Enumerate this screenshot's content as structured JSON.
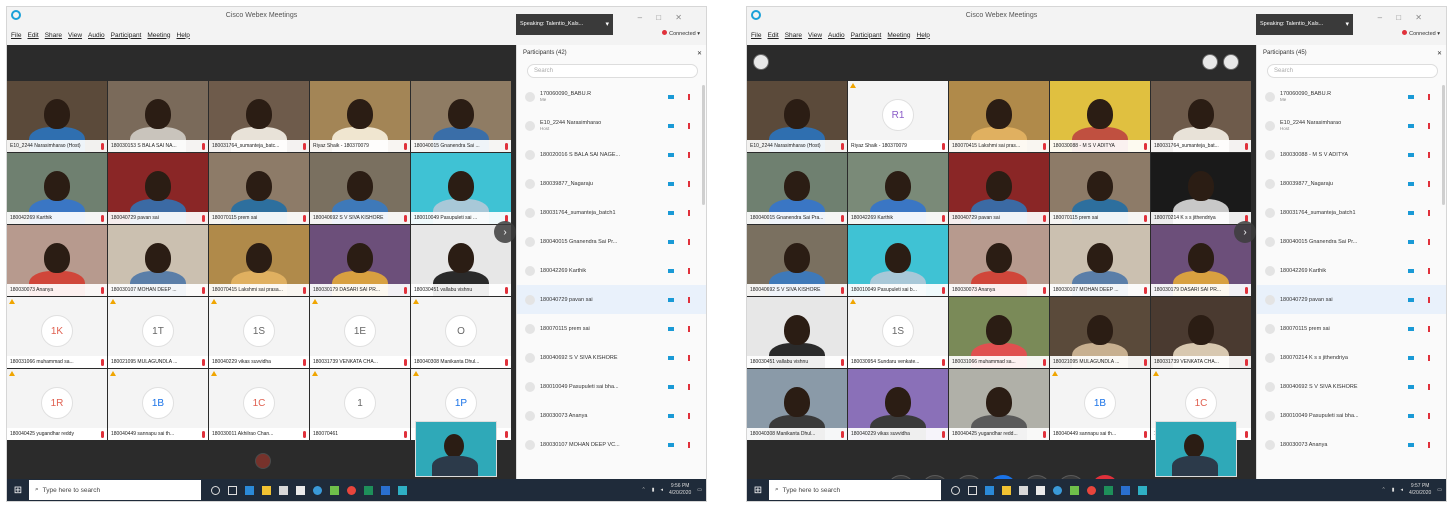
{
  "left": {
    "window_title": "Cisco Webex Meetings",
    "menu": [
      "File",
      "Edit",
      "Share",
      "View",
      "Audio",
      "Participant",
      "Meeting",
      "Help"
    ],
    "speaking": "Speaking: Talentio_Kals...",
    "connected": "Connected",
    "participants_label": "Participants (42)",
    "search_placeholder": "Search",
    "tiles": [
      {
        "label": "E10_2244 Narasimharao (Host)",
        "kind": "video",
        "bg": "#5b4a3a",
        "shirt": "#2f6fb0"
      },
      {
        "label": "180030153 S BALA SAI NA...",
        "kind": "video",
        "bg": "#7a6a5a",
        "shirt": "#c9c4bc"
      },
      {
        "label": "180031764_sumanteja_batc...",
        "kind": "video",
        "bg": "#6e5b4b",
        "shirt": "#e8e2d8"
      },
      {
        "label": "Riyaz Shaik - 180370079",
        "kind": "video",
        "bg": "#a38556",
        "shirt": "#f0e6d0"
      },
      {
        "label": "180040015 Gnanendra Sai ...",
        "kind": "video",
        "bg": "#8f7c64",
        "shirt": "#3a6ea8"
      },
      {
        "label": "180042269 Karthik",
        "kind": "video",
        "bg": "#6f8070",
        "shirt": "#3a76c4"
      },
      {
        "label": "180040729 pavan sai",
        "kind": "video",
        "bg": "#8a2626",
        "shirt": "#3b6aa4"
      },
      {
        "label": "180070115 prem sai",
        "kind": "video",
        "bg": "#8d7b68",
        "shirt": "#2d6f9e"
      },
      {
        "label": "180040692 S V SIVA KISHORE",
        "kind": "video",
        "bg": "#7a7060",
        "shirt": "#3e79b9"
      },
      {
        "label": "180010049 Pasupuleti sai ...",
        "kind": "video",
        "bg": "#3fc2d4",
        "shirt": "#a8c8d8"
      },
      {
        "label": "180030073 Ananya",
        "kind": "video",
        "bg": "#b79a8e",
        "shirt": "#d0463a"
      },
      {
        "label": "180030107 MOHAN DEEP ...",
        "kind": "video",
        "bg": "#cbc0b0",
        "shirt": "#5a7ea8"
      },
      {
        "label": "180070415 Lakshmi sai prasa...",
        "kind": "video",
        "bg": "#b08a4a",
        "shirt": "#e0b060"
      },
      {
        "label": "180030179 DASARI SAI PR...",
        "kind": "video",
        "bg": "#6c4f7a",
        "shirt": "#d8a040"
      },
      {
        "label": "180030451 vallabu vishnu",
        "kind": "video",
        "bg": "#e7e7e7",
        "shirt": "#2a2a2a"
      },
      {
        "label": "180031066 muhammad sa...",
        "kind": "avatar",
        "initials": "1K",
        "color": "#e06050"
      },
      {
        "label": "180021095 MULAGUNDLA ...",
        "kind": "avatar",
        "initials": "1T",
        "color": "#666666"
      },
      {
        "label": "180040229 vikas suvvidha",
        "kind": "avatar",
        "initials": "1S",
        "color": "#666666"
      },
      {
        "label": "180031739 VENKATA CHA...",
        "kind": "avatar",
        "initials": "1E",
        "color": "#666666"
      },
      {
        "label": "180040308 Manikanta Dhul...",
        "kind": "avatar",
        "initials": "O",
        "color": "#666666"
      },
      {
        "label": "180040425 yugandhar reddy",
        "kind": "avatar",
        "initials": "1R",
        "color": "#e06050"
      },
      {
        "label": "180040449 sannapu sai th...",
        "kind": "avatar",
        "initials": "1B",
        "color": "#1a73e8"
      },
      {
        "label": "180030011 Akhilrao Chan...",
        "kind": "avatar",
        "initials": "1C",
        "color": "#e06050"
      },
      {
        "label": "180070461",
        "kind": "avatar",
        "initials": "1",
        "color": "#666666"
      },
      {
        "label": "",
        "kind": "avatar",
        "initials": "1P",
        "color": "#1a73e8"
      }
    ],
    "participants": [
      {
        "name": "170060090_BABU.R",
        "sub": "Me"
      },
      {
        "name": "E10_2244 Narasimharao",
        "sub": "Host"
      },
      {
        "name": "180020016 S BALA SAI NAGE...",
        "sub": ""
      },
      {
        "name": "180039877_Nagaraju",
        "sub": ""
      },
      {
        "name": "180031764_sumanteja_batch1",
        "sub": ""
      },
      {
        "name": "180040015 Gnanendra Sai Pr...",
        "sub": ""
      },
      {
        "name": "180042269 Karthik",
        "sub": ""
      },
      {
        "name": "180040729 pavan sai",
        "sub": ""
      },
      {
        "name": "180070115 prem sai",
        "sub": ""
      },
      {
        "name": "180040692 S V SIVA KISHORE",
        "sub": ""
      },
      {
        "name": "180010049 Pasupuleti sai bha...",
        "sub": ""
      },
      {
        "name": "180030073 Ananya",
        "sub": ""
      },
      {
        "name": "180030107 MOHAN DEEP VC...",
        "sub": ""
      }
    ],
    "taskbar_search": "Type here to search",
    "clock_time": "9:56 PM",
    "clock_date": "4/20/2020"
  },
  "right": {
    "window_title": "Cisco Webex Meetings",
    "menu": [
      "File",
      "Edit",
      "Share",
      "View",
      "Audio",
      "Participant",
      "Meeting",
      "Help"
    ],
    "speaking": "Speaking: Talentio_Kals...",
    "connected": "Connected",
    "participants_label": "Participants (45)",
    "search_placeholder": "Search",
    "tiles": [
      {
        "label": "E10_2244 Narasimharao (Host)",
        "kind": "video",
        "bg": "#5b4a3a",
        "shirt": "#2f6fb0"
      },
      {
        "label": "Riyaz Shaik - 180370079",
        "kind": "avatar",
        "initials": "R1",
        "color": "#8a5cc8"
      },
      {
        "label": "180070415 Lakshmi sai pras...",
        "kind": "video",
        "bg": "#b08a4a",
        "shirt": "#e0b060"
      },
      {
        "label": "180030088 - M S V ADITYA",
        "kind": "video",
        "bg": "#e0c040",
        "shirt": "#c05040"
      },
      {
        "label": "180031764_sumanteja_bat...",
        "kind": "video",
        "bg": "#6e5b4b",
        "shirt": "#e8e2d8"
      },
      {
        "label": "180040015 Gnanendra Sai Pra...",
        "kind": "video",
        "bg": "#6f8070",
        "shirt": "#3a76c4"
      },
      {
        "label": "180042269 Karthik",
        "kind": "video",
        "bg": "#7a8a78",
        "shirt": "#3a76c4"
      },
      {
        "label": "180040729 pavan sai",
        "kind": "video",
        "bg": "#8a2626",
        "shirt": "#3b6aa4"
      },
      {
        "label": "180070115 prem sai",
        "kind": "video",
        "bg": "#8d7b68",
        "shirt": "#2d6f9e"
      },
      {
        "label": "180070214 K s s jithendriya",
        "kind": "video",
        "bg": "#1a1a1a",
        "shirt": "#c8c8c8"
      },
      {
        "label": "180040692 S V SIVA KISHORE",
        "kind": "video",
        "bg": "#7a7060",
        "shirt": "#3e79b9"
      },
      {
        "label": "180010049 Pasupuleti sai b...",
        "kind": "video",
        "bg": "#3fc2d4",
        "shirt": "#a8c8d8"
      },
      {
        "label": "180030073 Ananya",
        "kind": "video",
        "bg": "#b79a8e",
        "shirt": "#d0463a"
      },
      {
        "label": "180030107 MOHAN DEEP ...",
        "kind": "video",
        "bg": "#cbc0b0",
        "shirt": "#5a7ea8"
      },
      {
        "label": "180030179 DASARI SAI PR...",
        "kind": "video",
        "bg": "#6c4f7a",
        "shirt": "#d8a040"
      },
      {
        "label": "180030451 vallabu vishnu",
        "kind": "video",
        "bg": "#e7e7e7",
        "shirt": "#2a2a2a"
      },
      {
        "label": "180030954 Sundaru venkate...",
        "kind": "avatar",
        "initials": "1S",
        "color": "#666666"
      },
      {
        "label": "180031066 muhammad sa...",
        "kind": "video",
        "bg": "#7a8a58",
        "shirt": "#e05050"
      },
      {
        "label": "180021095 MULAGUNDLA ...",
        "kind": "video",
        "bg": "#5a4a3a",
        "shirt": "#c8b090"
      },
      {
        "label": "180031739 VENKATA CHA...",
        "kind": "video",
        "bg": "#4a3a30",
        "shirt": "#d8c8b0"
      },
      {
        "label": "180040308 Manikanta Dhul...",
        "kind": "video",
        "bg": "#8a9aa8",
        "shirt": "#3a3a3a"
      },
      {
        "label": "180040229 vikas suvvidha",
        "kind": "video",
        "bg": "#8a70b8",
        "shirt": "#3a3a3a"
      },
      {
        "label": "180040425 yugandhar redd...",
        "kind": "video",
        "bg": "#b0b0a8",
        "shirt": "#5a5a5a"
      },
      {
        "label": "180040449 sannapu sai th...",
        "kind": "avatar",
        "initials": "1B",
        "color": "#1a73e8"
      },
      {
        "label": "180030011 Akhilrao Chan...",
        "kind": "avatar",
        "initials": "1C",
        "color": "#e06050"
      }
    ],
    "participants": [
      {
        "name": "170060090_BABU.R",
        "sub": "Me"
      },
      {
        "name": "E10_2244 Narasimharao",
        "sub": "Host"
      },
      {
        "name": "180030088 - M S V ADITYA",
        "sub": ""
      },
      {
        "name": "180039877_Nagaraju",
        "sub": ""
      },
      {
        "name": "180031764_sumanteja_batch1",
        "sub": ""
      },
      {
        "name": "180040015 Gnanendra Sai Pr...",
        "sub": ""
      },
      {
        "name": "180042269 Karthik",
        "sub": ""
      },
      {
        "name": "180040729 pavan sai",
        "sub": ""
      },
      {
        "name": "180070115 prem sai",
        "sub": ""
      },
      {
        "name": "180070214 K s s jithendriya",
        "sub": ""
      },
      {
        "name": "180040692 S V SIVA KISHORE",
        "sub": ""
      },
      {
        "name": "180010049 Pasupuleti sai bha...",
        "sub": ""
      },
      {
        "name": "180030073 Ananya",
        "sub": ""
      }
    ],
    "taskbar_search": "Type here to search",
    "clock_time": "9:57 PM",
    "clock_date": "4/20/2020"
  },
  "colors": {
    "accent": "#1a73e8",
    "mute": "#e0313b",
    "taskbar": "#1f2b3a",
    "stage": "#2b2b2b"
  },
  "icons": [
    "webex-logo-icon",
    "participants-icon",
    "search-icon",
    "mic-muted-icon",
    "camera-icon",
    "windows-start-icon",
    "next-page-icon",
    "share-icon",
    "end-call-icon"
  ]
}
